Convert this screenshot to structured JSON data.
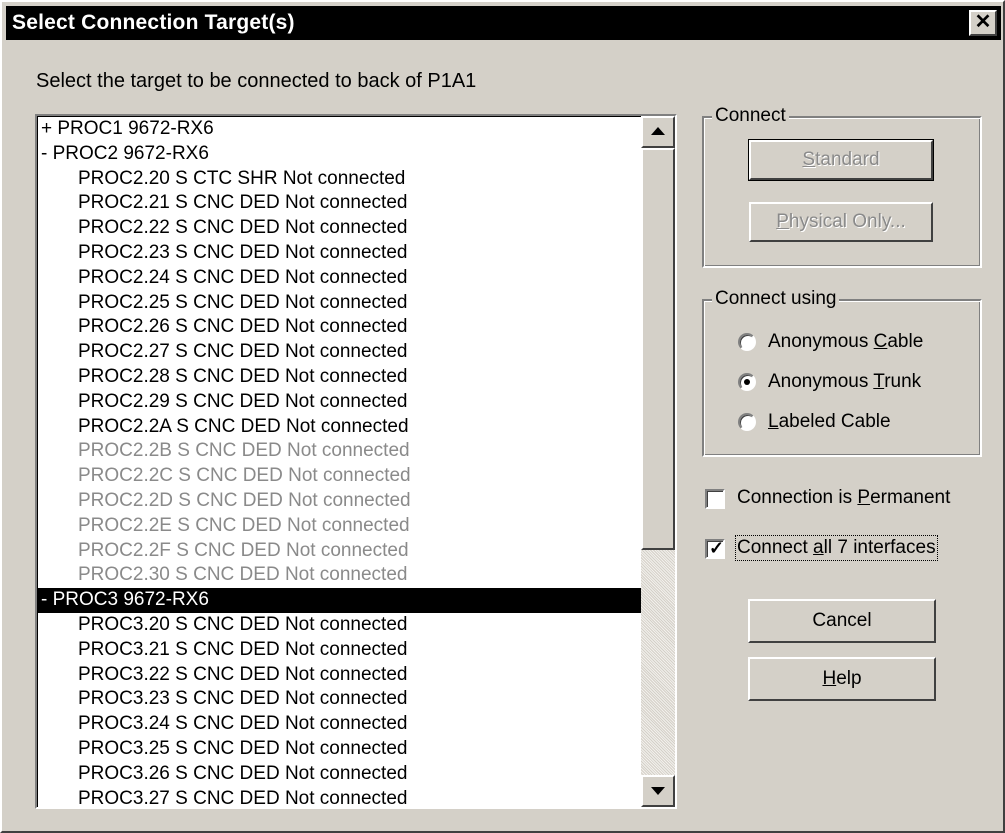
{
  "window": {
    "title": "Select Connection Target(s)",
    "close_glyph": "✕"
  },
  "prompt": "Select the target to be connected to back of P1A1",
  "list": [
    {
      "text": "+ PROC1 9672-RX6",
      "level": 0,
      "state": "normal"
    },
    {
      "text": "-  PROC2 9672-RX6",
      "level": 0,
      "state": "normal"
    },
    {
      "text": "PROC2.20 S CTC SHR Not connected",
      "level": 1,
      "state": "normal"
    },
    {
      "text": "PROC2.21 S CNC DED Not connected",
      "level": 1,
      "state": "normal"
    },
    {
      "text": "PROC2.22 S CNC DED Not connected",
      "level": 1,
      "state": "normal"
    },
    {
      "text": "PROC2.23 S CNC DED Not connected",
      "level": 1,
      "state": "normal"
    },
    {
      "text": "PROC2.24 S CNC DED Not connected",
      "level": 1,
      "state": "normal"
    },
    {
      "text": "PROC2.25 S CNC DED Not connected",
      "level": 1,
      "state": "normal"
    },
    {
      "text": "PROC2.26 S CNC DED Not connected",
      "level": 1,
      "state": "normal"
    },
    {
      "text": "PROC2.27 S CNC DED Not connected",
      "level": 1,
      "state": "normal"
    },
    {
      "text": "PROC2.28 S CNC DED Not connected",
      "level": 1,
      "state": "normal"
    },
    {
      "text": "PROC2.29 S CNC DED Not connected",
      "level": 1,
      "state": "normal"
    },
    {
      "text": "PROC2.2A S CNC DED Not connected",
      "level": 1,
      "state": "normal"
    },
    {
      "text": "PROC2.2B S CNC DED Not connected",
      "level": 1,
      "state": "dim"
    },
    {
      "text": "PROC2.2C S CNC DED Not connected",
      "level": 1,
      "state": "dim"
    },
    {
      "text": "PROC2.2D S CNC DED Not connected",
      "level": 1,
      "state": "dim"
    },
    {
      "text": "PROC2.2E S CNC DED Not connected",
      "level": 1,
      "state": "dim"
    },
    {
      "text": "PROC2.2F S CNC DED Not connected",
      "level": 1,
      "state": "dim"
    },
    {
      "text": "PROC2.30 S CNC DED Not connected",
      "level": 1,
      "state": "dim"
    },
    {
      "text": "-  PROC3 9672-RX6",
      "level": 0,
      "state": "selected"
    },
    {
      "text": "PROC3.20 S CNC DED Not connected",
      "level": 1,
      "state": "normal"
    },
    {
      "text": "PROC3.21 S CNC DED Not connected",
      "level": 1,
      "state": "normal"
    },
    {
      "text": "PROC3.22 S CNC DED Not connected",
      "level": 1,
      "state": "normal"
    },
    {
      "text": "PROC3.23 S CNC DED Not connected",
      "level": 1,
      "state": "normal"
    },
    {
      "text": "PROC3.24 S CNC DED Not connected",
      "level": 1,
      "state": "normal"
    },
    {
      "text": "PROC3.25 S CNC DED Not connected",
      "level": 1,
      "state": "normal"
    },
    {
      "text": "PROC3.26 S CNC DED Not connected",
      "level": 1,
      "state": "normal"
    },
    {
      "text": "PROC3.27 S CNC DED Not connected",
      "level": 1,
      "state": "normal"
    }
  ],
  "connect_group": {
    "title": "Connect",
    "standard": {
      "pre": "",
      "key": "S",
      "post": "tandard"
    },
    "physical_only": {
      "pre": "",
      "key": "P",
      "post": "hysical Only..."
    }
  },
  "connect_using": {
    "title": "Connect using",
    "options": [
      {
        "pre": "Anonymous ",
        "key": "C",
        "post": "able",
        "selected": false
      },
      {
        "pre": "Anonymous ",
        "key": "T",
        "post": "runk",
        "selected": true
      },
      {
        "pre": "",
        "key": "L",
        "post": "abeled Cable",
        "selected": false
      }
    ]
  },
  "checkboxes": {
    "permanent": {
      "pre": "Connection is ",
      "key": "P",
      "post": "ermanent",
      "checked": false
    },
    "all_interfaces": {
      "pre": "Connect ",
      "key": "a",
      "post": "ll 7 interfaces",
      "checked": true
    }
  },
  "buttons": {
    "cancel": "Cancel",
    "help": {
      "pre": "",
      "key": "H",
      "post": "elp"
    }
  },
  "colors": {
    "face": "#d4d0c8",
    "title_bar": "#000000",
    "selected_row": "#000000",
    "disabled_text": "#8a8a8a"
  },
  "icons": {
    "close": "close-icon",
    "scroll_up": "scroll-up-arrow-icon",
    "scroll_down": "scroll-down-arrow-icon",
    "check": "checkmark-icon"
  }
}
